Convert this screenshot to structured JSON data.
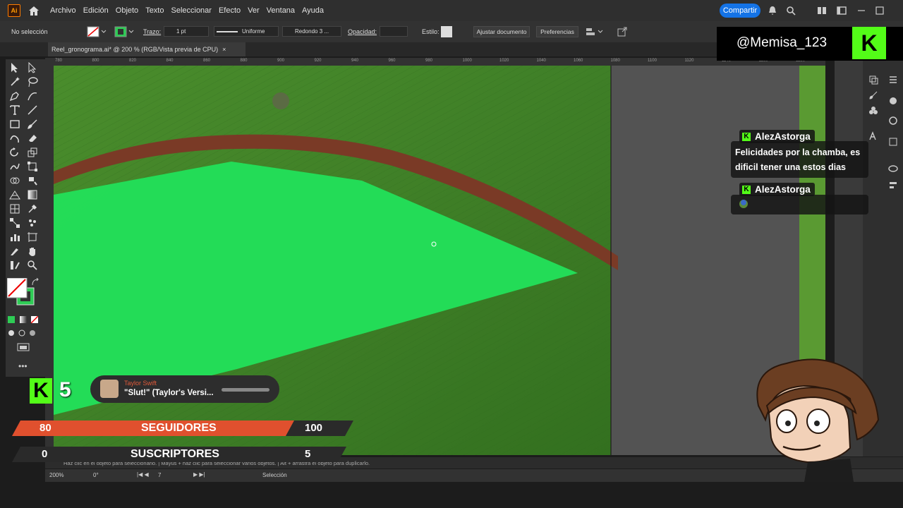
{
  "app": {
    "logo": "Ai",
    "home_icon": "home-icon"
  },
  "menu": [
    "Archivo",
    "Edición",
    "Objeto",
    "Texto",
    "Seleccionar",
    "Efecto",
    "Ver",
    "Ventana",
    "Ayuda"
  ],
  "share_label": "Compartir",
  "control": {
    "selection": "No selección",
    "trazo_label": "Trazo:",
    "stroke_weight": "1 pt",
    "stroke_profile": "Uniforme",
    "brush": "Redondo 3 ...",
    "opacity_label": "Opacidad:",
    "style_label": "Estilo:",
    "adjust_doc": "Ajustar documento",
    "preferences": "Preferencias"
  },
  "doc_tab": {
    "title": "Reel_gronograma.ai* @ 200 % (RGB/Vista previa de CPU)",
    "close": "×"
  },
  "ruler_ticks": [
    "780",
    "800",
    "820",
    "840",
    "860",
    "880",
    "900",
    "920",
    "940",
    "960",
    "980",
    "1000",
    "1020",
    "1040",
    "1060",
    "1080",
    "1100",
    "1120",
    "1140",
    "1160",
    "1180"
  ],
  "status_hint": "Haz clic en el objeto para seleccionarlo.  |  Mayús + haz clic para seleccionar varios objetos.  |  Alt + arrastra el objeto para duplicarlo.",
  "bottom": {
    "zoom": "200%",
    "rotation": "0°",
    "artboard": "7",
    "tool_status": "Selección"
  },
  "overlay": {
    "handle": "@Memisa_123",
    "kick_letter": "K",
    "chat": [
      {
        "user": "AlezAstorga",
        "message": "Felicidades por la chamba, es dificil tener una estos dias"
      },
      {
        "user": "AlezAstorga",
        "message": ""
      }
    ],
    "sub_count": "5",
    "song": {
      "artist": "Taylor Swift",
      "title": "\"Slut!\" (Taylor's Versi..."
    },
    "followers": {
      "current": "80",
      "label": "SEGUIDORES",
      "goal": "100"
    },
    "subscribers": {
      "current": "0",
      "label": "SUSCRIPTORES",
      "goal": "5"
    }
  },
  "colors": {
    "accent": "#1473e6",
    "kick": "#53fc18",
    "shape": "#22e05a",
    "follow_bar": "#e0502e"
  }
}
